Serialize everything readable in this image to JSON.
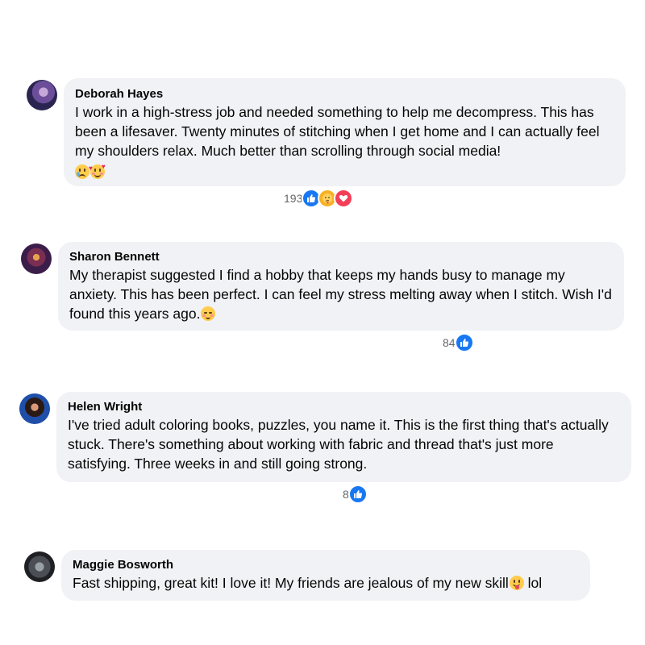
{
  "comments": [
    {
      "author": "Deborah Hayes",
      "text": "I work in a high-stress job and needed something to help me decompress. This has been a lifesaver. Twenty minutes of stitching when I get home and I can actually feel my shoulders relax. Much better than scrolling through social media!",
      "emojis": [
        "sad-tear-emoji-icon",
        "smiling-hearts-emoji-icon"
      ],
      "reaction_count": "193",
      "reactions": [
        "like-reaction-icon",
        "care-reaction-icon",
        "love-reaction-icon"
      ]
    },
    {
      "author": "Sharon Bennett",
      "text": "My therapist suggested I find a hobby that keeps my hands busy to manage my anxiety. This has been perfect. I can feel my stress melting away when I stitch. Wish I'd found this years ago.",
      "emojis": [
        "relieved-face-emoji-icon"
      ],
      "reaction_count": "84",
      "reactions": [
        "like-reaction-icon"
      ]
    },
    {
      "author": "Helen Wright",
      "text": "I've tried adult coloring books, puzzles, you name it. This is the first thing that's actually stuck. There's something about working with fabric and thread that's just more satisfying. Three weeks in and still going strong.",
      "emojis": [],
      "reaction_count": "8",
      "reactions": [
        "like-reaction-icon"
      ]
    },
    {
      "author": "Maggie Bosworth",
      "text": "Fast shipping, great kit! I love it! My friends are jealous of my new skill",
      "text_after_emoji": " lol",
      "emojis": [
        "tongue-face-emoji-icon"
      ],
      "reaction_count": "",
      "reactions": []
    }
  ],
  "colors": {
    "bubble": "#f0f2f5",
    "like": "#1877f2",
    "love": "#f33e58",
    "care": "#f7b125",
    "meta_text": "#65676b"
  }
}
